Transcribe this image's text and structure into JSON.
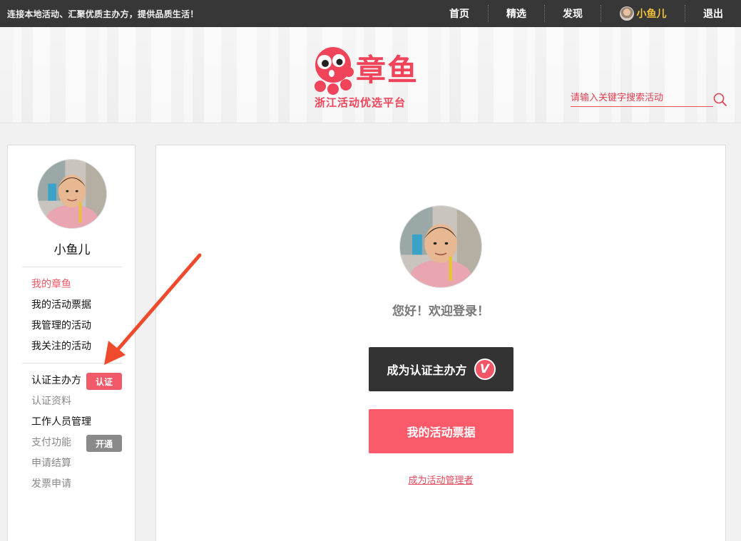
{
  "topbar": {
    "slogan": "连接本地活动、汇聚优质主办方，提供品质生活！",
    "nav": [
      "首页",
      "精选",
      "发现"
    ],
    "user_name": "小鱼儿",
    "logout": "退出"
  },
  "header": {
    "logo_title": "章鱼",
    "logo_subtitle": "浙江活动优选平台",
    "search_placeholder": "请输入关键字搜索活动"
  },
  "sidebar": {
    "user_name": "小鱼儿",
    "group1": [
      "我的章鱼",
      "我的活动票据",
      "我管理的活动",
      "我关注的活动"
    ],
    "group2": [
      "认证主办方",
      "认证资料",
      "工作人员管理",
      "支付功能",
      "申请结算",
      "发票申请"
    ],
    "badge_certify": "认证",
    "badge_open": "开通"
  },
  "main": {
    "welcome": "您好！欢迎登录！",
    "become_organizer": "成为认证主办方",
    "v_badge": "V",
    "my_tickets": "我的活动票据",
    "become_admin": "成为活动管理者"
  },
  "colors": {
    "brand_red": "#f0445a",
    "button_red": "#fb5a6a",
    "dark": "#333333",
    "topbar": "#373737",
    "user_gold": "#f5c33b"
  }
}
